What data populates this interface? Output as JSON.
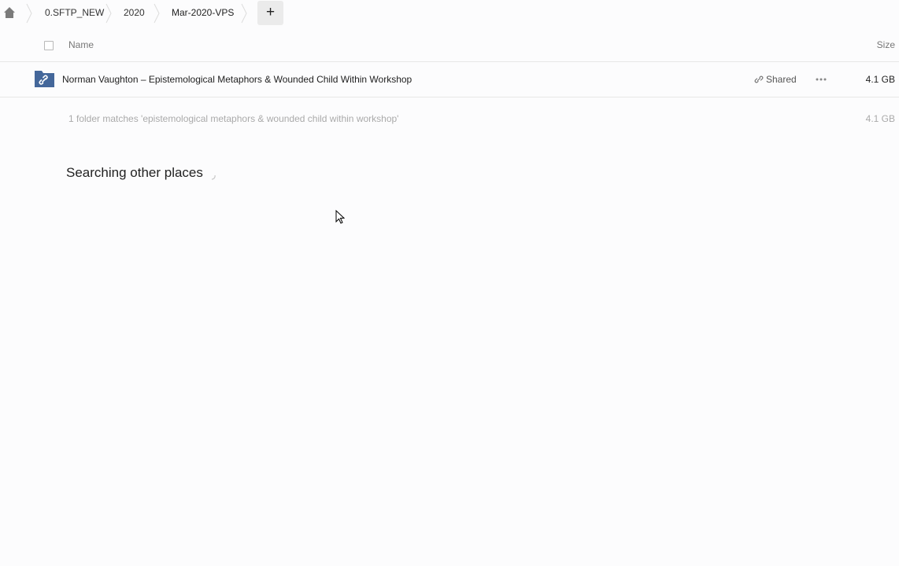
{
  "breadcrumb": {
    "home_icon": "home-icon",
    "items": [
      {
        "label": "0.SFTP_NEW"
      },
      {
        "label": "2020"
      },
      {
        "label": "Mar-2020-VPS"
      }
    ],
    "add_label": "+"
  },
  "columns": {
    "name": "Name",
    "size": "Size"
  },
  "files": [
    {
      "name": "Norman Vaughton – Epistemological Metaphors & Wounded Child Within Workshop",
      "icon": "shared-folder-icon",
      "shared_label": "Shared",
      "size": "4.1 GB"
    }
  ],
  "summary": {
    "text": "1 folder matches 'epistemological metaphors & wounded child within workshop'",
    "size": "4.1 GB"
  },
  "search_status": "Searching other places",
  "colors": {
    "folder": "#44679a",
    "background": "#fcfcfd",
    "muted_text": "#aaaaaa"
  }
}
